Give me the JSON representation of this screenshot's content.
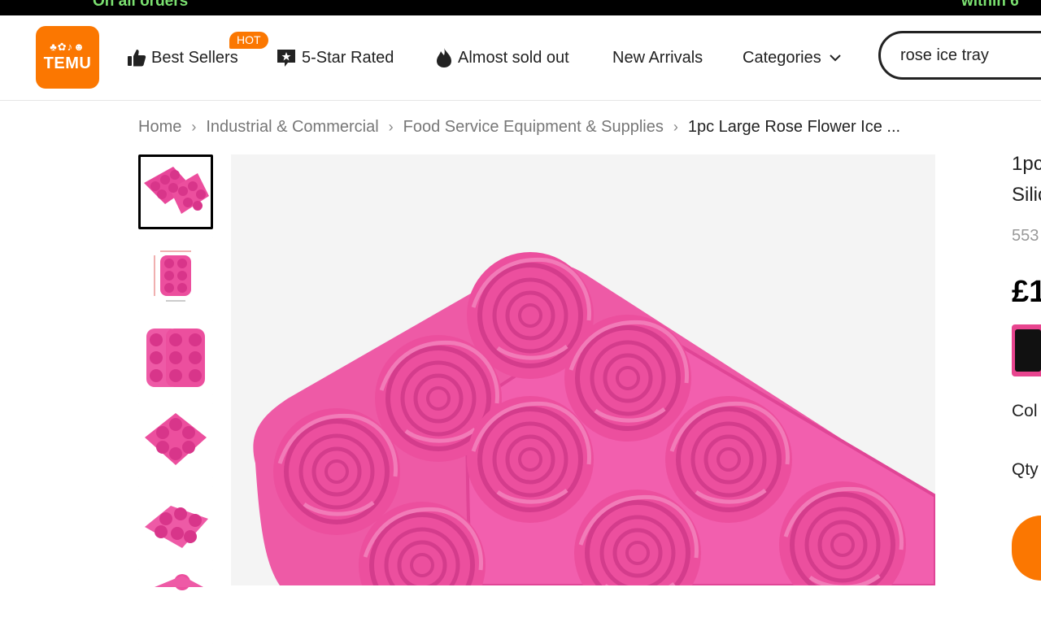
{
  "top_banner": {
    "left_text": "On all orders",
    "right_text": "within 6"
  },
  "header": {
    "logo_text": "TEMU",
    "nav": [
      {
        "label": "Best Sellers",
        "badge": "HOT"
      },
      {
        "label": "5-Star Rated"
      },
      {
        "label": "Almost sold out"
      },
      {
        "label": "New Arrivals"
      },
      {
        "label": "Categories"
      }
    ],
    "search_value": "rose ice tray"
  },
  "breadcrumb": [
    "Home",
    "Industrial & Commercial",
    "Food Service Equipment & Supplies",
    "1pc Large Rose Flower Ice ..."
  ],
  "gallery": {
    "thumbnail_count": 6,
    "selected_index": 0
  },
  "product": {
    "title_line1": "1pc",
    "title_line2": "Silic",
    "sold_count": "553",
    "price": "£1",
    "color_label": "Col",
    "qty_label": "Qty"
  },
  "colors": {
    "brand": "#fb7701",
    "product_pink": "#ec4f9e",
    "banner_green": "#7be070"
  }
}
